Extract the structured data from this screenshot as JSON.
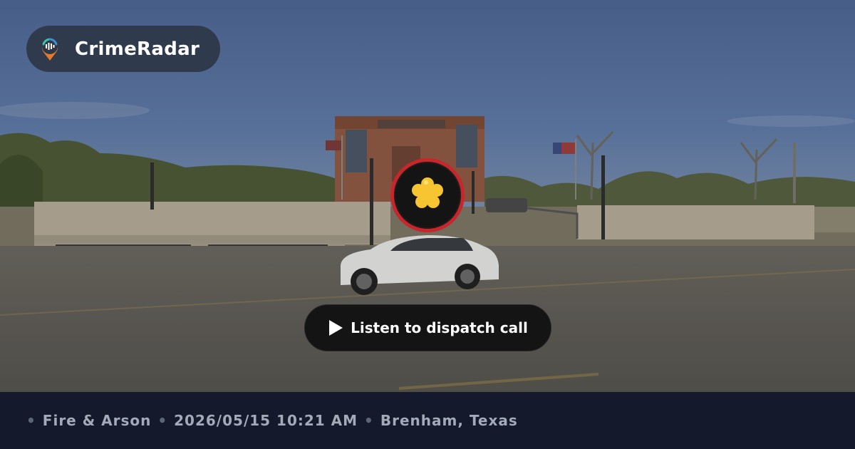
{
  "brand": {
    "name": "CrimeRadar",
    "logo_icon": "radar-pin-icon"
  },
  "incident": {
    "icon": "fire-incident-icon",
    "accent_color": "#c8262a"
  },
  "listen_button": {
    "label": "Listen to dispatch call",
    "icon": "play-icon"
  },
  "meta": {
    "separator": "•",
    "category": "Fire & Arson",
    "datetime": "2026/05/15 10:21 AM",
    "location": "Brenham, Texas"
  },
  "colors": {
    "footer_bg": "#141a2b",
    "meta_text": "#a3aab8",
    "badge_ring": "#c8262a"
  }
}
